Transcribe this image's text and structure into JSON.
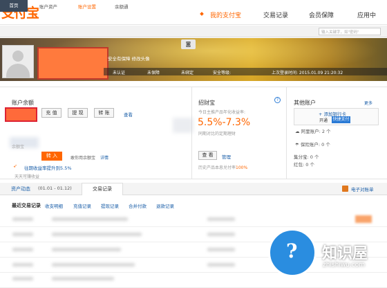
{
  "brand": {
    "logo": "支付宝"
  },
  "topnav": {
    "my_alipay": "我的支付宝",
    "trade_records": "交易记录",
    "member": "会员保障",
    "apps": "应用中"
  },
  "subnav": {
    "home": "首页",
    "assets": "账户资产",
    "settings": "账户设置",
    "yeb": "余额通"
  },
  "search": {
    "placeholder": "输入关键字，如\"密码\""
  },
  "profile": {
    "insurance": "安全有保障  修改头像",
    "verify": "未认证",
    "protect": "未保障",
    "bind": "未绑定",
    "security_level": "安全等级: ",
    "last_login": "上次登录时间: 2015.01.09 21:20:32"
  },
  "balance": {
    "title": "账户余额",
    "recharge": "充 值",
    "withdraw": "提 现",
    "transfer": "转 账",
    "view": "查看"
  },
  "yeb": {
    "label": "余额宝",
    "transfer_in": "转 入",
    "hint": "敢你用余额宝",
    "detail": "详情",
    "rate": "往期收益率提升到5.5%",
    "daily": "天天可赚收益"
  },
  "zcb": {
    "title": "招财宝",
    "desc": "今日主推产品年化收益率:",
    "rate": "5.5%-7.3%",
    "sub": "同期对比的定期理财",
    "view_btn": "查 看",
    "manage": "管理",
    "history": "历史产品本息兑付率",
    "history_rate": "100%"
  },
  "other": {
    "title": "其他账户",
    "more": "更多",
    "add_card": "+ 添加银行卡",
    "open": "开通",
    "quick_pay": "快捷支付",
    "credit": "阿里账户: 2 个",
    "insure": "保险账户: 0 个",
    "jcb": "集分宝: 0 个",
    "hb": "红包: 0 个"
  },
  "tabs": {
    "dynamic": "资产动态",
    "range": "(01.01 - 01.12)",
    "trades": "交易记录",
    "bill": "电子对账单"
  },
  "records": {
    "title": "最近交易记录",
    "links": [
      "收支明细",
      "充值记录",
      "提现记录",
      "合并付款",
      "退款记录"
    ]
  },
  "watermark": {
    "name": "知识屋",
    "url": "zhishiwu.com"
  },
  "colors": {
    "accent": "#ff6600",
    "link": "#1a5ea8",
    "nav_dark": "#3b4a5c"
  }
}
